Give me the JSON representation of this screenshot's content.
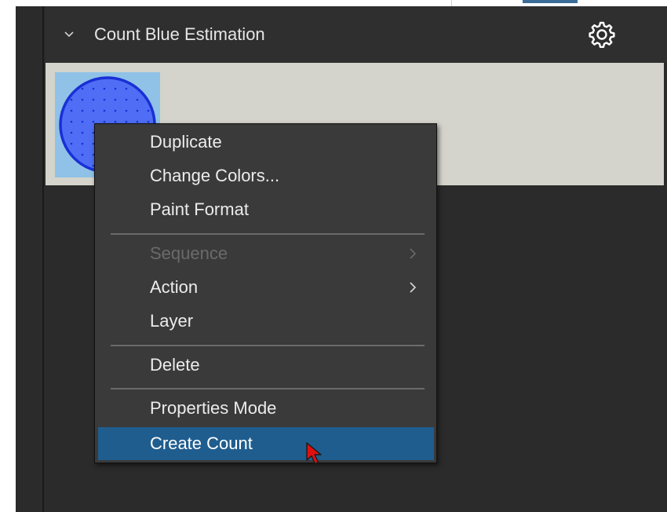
{
  "panel": {
    "title": "Count Blue Estimation",
    "collapse_icon": "chevron-down-icon",
    "settings_icon": "gear-icon"
  },
  "thumbnail": {
    "icon": "blue-circle-count-symbol",
    "fill_color": "#4f6ef5",
    "stroke_color": "#1a2fd6",
    "background_color": "#8fc2e6"
  },
  "context_menu": {
    "items": [
      {
        "label": "Duplicate",
        "enabled": true
      },
      {
        "label": "Change Colors...",
        "enabled": true
      },
      {
        "label": "Paint Format",
        "enabled": true
      },
      {
        "label": "Sequence",
        "enabled": false,
        "submenu": true
      },
      {
        "label": "Action",
        "enabled": true,
        "submenu": true
      },
      {
        "label": "Layer",
        "enabled": true
      },
      {
        "label": "Delete",
        "enabled": true
      },
      {
        "label": "Properties Mode",
        "enabled": true
      },
      {
        "label": "Create Count",
        "enabled": true,
        "highlighted": true
      }
    ],
    "highlight_color": "#1f5d8f"
  },
  "cursor": {
    "icon": "mouse-pointer-icon",
    "color": "#e01010"
  }
}
